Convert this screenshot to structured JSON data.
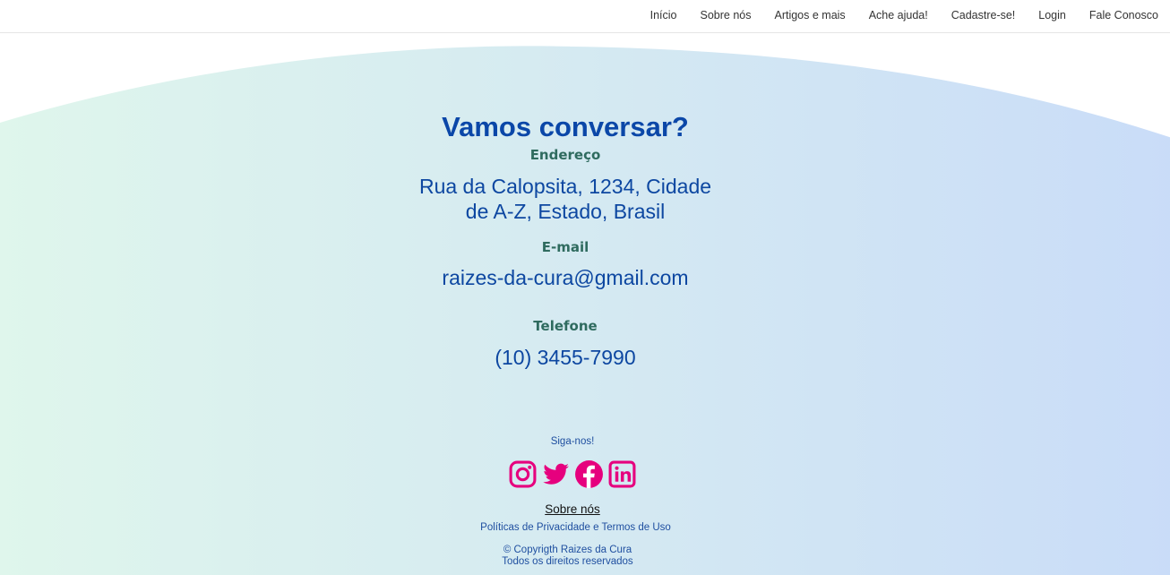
{
  "nav": {
    "items": [
      {
        "label": "Início"
      },
      {
        "label": "Sobre nós"
      },
      {
        "label": "Artigos e mais"
      },
      {
        "label": "Ache ajuda!"
      },
      {
        "label": "Cadastre-se!"
      },
      {
        "label": "Login"
      },
      {
        "label": "Fale Conosco"
      }
    ]
  },
  "contact": {
    "title": "Vamos conversar?",
    "address_label": "Endereço",
    "address_value": "Rua da Calopsita, 1234, Cidade de A-Z, Estado, Brasil",
    "email_label": "E-mail",
    "email_value": "raizes-da-cura@gmail.com",
    "phone_label": "Telefone",
    "phone_value": "(10) 3455-7990"
  },
  "footer": {
    "follow_label": "Siga-nos!",
    "social_icons": [
      "instagram-icon",
      "twitter-icon",
      "facebook-icon",
      "linkedin-icon"
    ],
    "about_link": "Sobre nós",
    "policies_link": "Políticas de Privacidade e Termos de Uso",
    "copyright_line1": "© Copyrigth Raizes da Cura",
    "copyright_line2": "Todos os direitos reservados"
  },
  "colors": {
    "title": "#0b47a8",
    "label": "#2f6b5f",
    "social": "#e6007e",
    "gradient_start": "#dcf5ea",
    "gradient_end": "#c9dcf8"
  }
}
